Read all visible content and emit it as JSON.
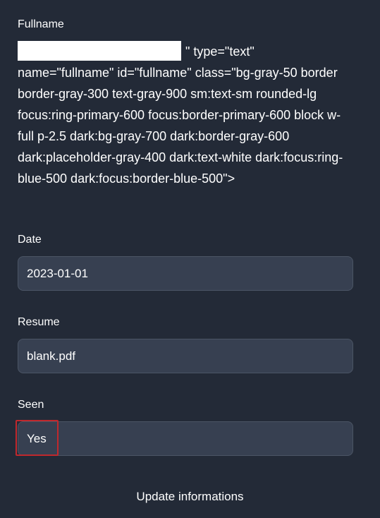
{
  "form": {
    "fullname": {
      "label": "Fullname",
      "broken_markup": "\" type=\"text\" name=\"fullname\" id=\"fullname\" class=\"bg-gray-50 border border-gray-300 text-gray-900 sm:text-sm rounded-lg focus:ring-primary-600 focus:border-primary-600 block w-full p-2.5 dark:bg-gray-700 dark:border-gray-600 dark:placeholder-gray-400 dark:text-white dark:focus:ring-blue-500 dark:focus:border-blue-500\">"
    },
    "date": {
      "label": "Date",
      "value": "2023-01-01"
    },
    "resume": {
      "label": "Resume",
      "value": "blank.pdf"
    },
    "seen": {
      "label": "Seen",
      "value": "Yes"
    },
    "submit_label": "Update informations"
  },
  "colors": {
    "background": "#232a37",
    "input_background": "#374051",
    "input_border": "#4b5565",
    "highlight": "#c0282d"
  }
}
